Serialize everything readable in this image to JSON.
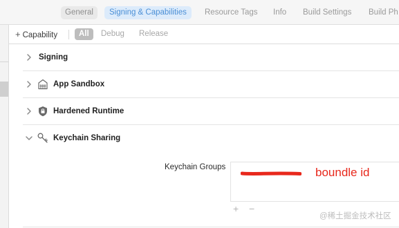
{
  "tabs": [
    {
      "label": "General",
      "state": "pill"
    },
    {
      "label": "Signing & Capabilities",
      "state": "selected"
    },
    {
      "label": "Resource Tags",
      "state": "normal"
    },
    {
      "label": "Info",
      "state": "normal"
    },
    {
      "label": "Build Settings",
      "state": "normal"
    },
    {
      "label": "Build Ph",
      "state": "normal"
    }
  ],
  "toolbar": {
    "add_capability_label": "Capability",
    "filters": [
      {
        "label": "All",
        "active": true
      },
      {
        "label": "Debug",
        "active": false
      },
      {
        "label": "Release",
        "active": false
      }
    ]
  },
  "sections": [
    {
      "title": "Signing",
      "icon": "none",
      "expanded": false
    },
    {
      "title": "App Sandbox",
      "icon": "sandbox-icon",
      "expanded": false
    },
    {
      "title": "Hardened Runtime",
      "icon": "lock-icon",
      "expanded": false
    },
    {
      "title": "Keychain Sharing",
      "icon": "keys-icon",
      "expanded": true
    }
  ],
  "keychain": {
    "groups_label": "Keychain Groups",
    "annotation": "boundle id",
    "add_symbol": "+",
    "remove_symbol": "−"
  },
  "watermark": "@稀土掘金技术社区",
  "colors": {
    "accent": "#4b8fd6",
    "selected_tab_bg": "#dcebfb",
    "annotation_red": "#e8281c"
  }
}
